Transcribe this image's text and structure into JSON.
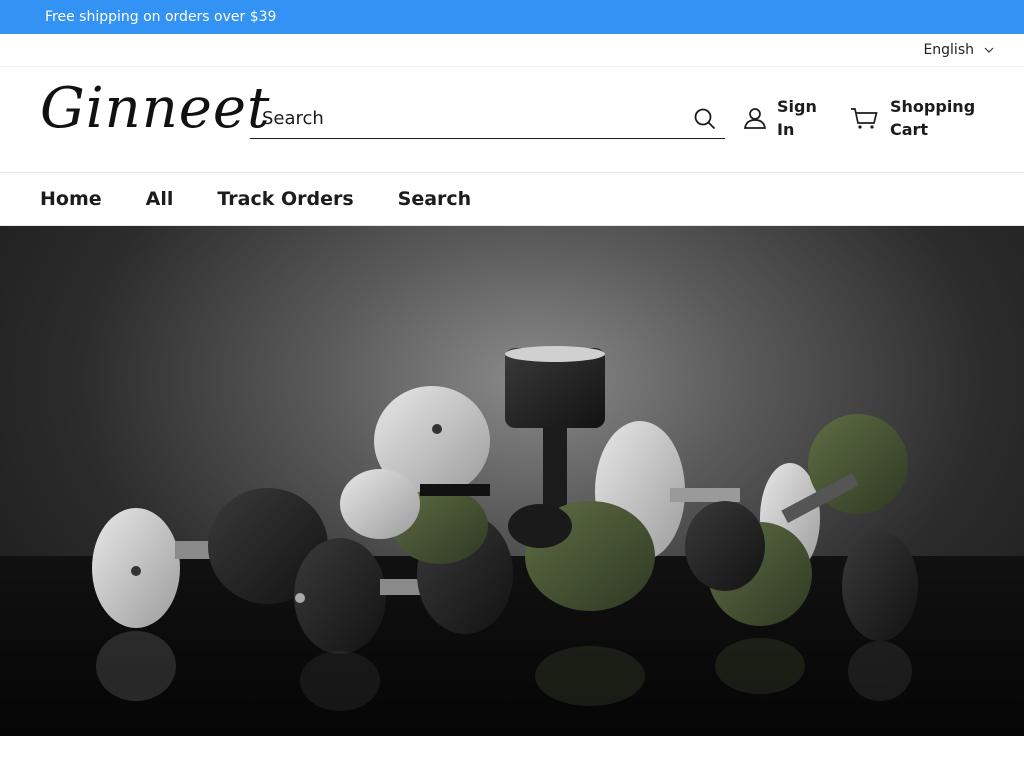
{
  "announcement": {
    "text": "Free shipping on orders over $39"
  },
  "utility": {
    "language": "English"
  },
  "header": {
    "logo": "Ginneet",
    "search_placeholder": "Search",
    "account_label": "Sign In",
    "cart_label": "Shopping Cart"
  },
  "nav": {
    "items": [
      {
        "label": "Home"
      },
      {
        "label": "All"
      },
      {
        "label": "Track Orders"
      },
      {
        "label": "Search"
      }
    ]
  },
  "colors": {
    "announcement_bg": "#3393f4",
    "text": "#1c1c1c",
    "olive": "#4b5a38"
  }
}
